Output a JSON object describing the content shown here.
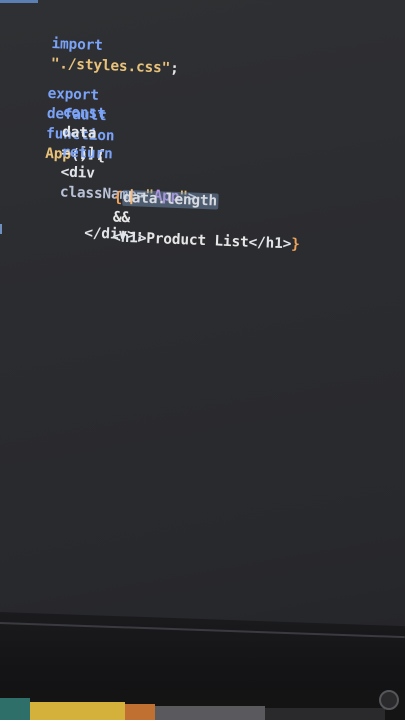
{
  "editor": {
    "lines": [
      {
        "import_kw": "import",
        "import_path": "\"./styles.css\"",
        "semicolon": ";"
      },
      {
        "export_kw": "export",
        "default_kw": "default",
        "function_kw": "function",
        "fn_name": "App",
        "fn_sig": "() {"
      },
      {
        "const_kw": "const",
        "var_name": "data",
        "assign": "= [];"
      },
      {
        "return_kw": "return",
        "open_tag": "<div",
        "attr_name": "className",
        "attr_eq": "=",
        "attr_value_q1": "\"",
        "attr_value": "App",
        "attr_value_q2": "\"",
        "close_bracket": ">"
      },
      {
        "brace_open": "{",
        "sel_first": "d",
        "sel_rest": "ata.length",
        "and_op": "&&",
        "h1_open": "<h1>",
        "h1_text": "Product List",
        "h1_close": "</h1>",
        "brace_close": "}"
      },
      {
        "div_close": "</div>;"
      }
    ]
  },
  "colors": {
    "keyword": "#7aa2f7",
    "string": "#e8c27a",
    "selection": "#7896be",
    "caret": "#f5b87a",
    "background": "#2c2d31"
  }
}
